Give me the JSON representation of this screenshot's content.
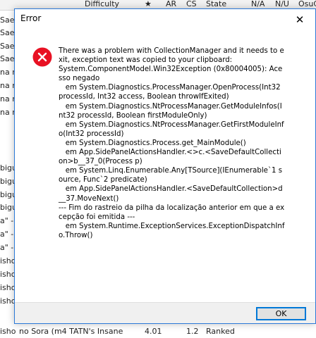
{
  "background": {
    "columns": [
      "Difficulty",
      "★",
      "AR",
      "CS",
      "State",
      "N/A",
      "N/U",
      "OsuG"
    ],
    "left_cells": [
      "Sae",
      "Sae",
      "Sae",
      "Sae",
      "na n",
      "na n",
      "na n",
      "na n",
      "",
      "",
      "bigu",
      "bigu",
      "bigu",
      "bigu",
      "a\" -",
      "a\" -",
      "a\" -",
      "isho",
      "isho",
      "isho",
      "isho"
    ],
    "bottom_row": {
      "left": "isho",
      "mid": "no Sora (m4 TATN's Insane",
      "value": "4.01",
      "num": "1.2",
      "state": "Ranked"
    }
  },
  "dialog": {
    "title": "Error",
    "close_icon": "✕",
    "message": "There was a problem with CollectionManager and it needs to exit, exception text was copied to your clipboard:\nSystem.ComponentModel.Win32Exception (0x80004005): Acesso negado\n   em System.Diagnostics.ProcessManager.OpenProcess(Int32 processId, Int32 access, Boolean throwIfExited)\n   em System.Diagnostics.NtProcessManager.GetModuleInfos(Int32 processId, Boolean firstModuleOnly)\n   em System.Diagnostics.NtProcessManager.GetFirstModuleInfo(Int32 processId)\n   em System.Diagnostics.Process.get_MainModule()\n   em App.SidePanelActionsHandler.<>c.<SaveDefaultCollection>b__37_0(Process p)\n   em System.Linq.Enumerable.Any[TSource](IEnumerable`1 source, Func`2 predicate)\n   em App.SidePanelActionsHandler.<SaveDefaultCollection>d__37.MoveNext()\n--- Fim do rastreio da pilha da localização anterior em que a excepção foi emitida ---\n   em System.Runtime.ExceptionServices.ExceptionDispatchInfo.Throw()",
    "ok_label": "OK"
  },
  "colors": {
    "accent": "#0078d7",
    "dialog_border": "#2b79d8",
    "error_red": "#e81123",
    "footer_bg": "#f0f0f0"
  }
}
